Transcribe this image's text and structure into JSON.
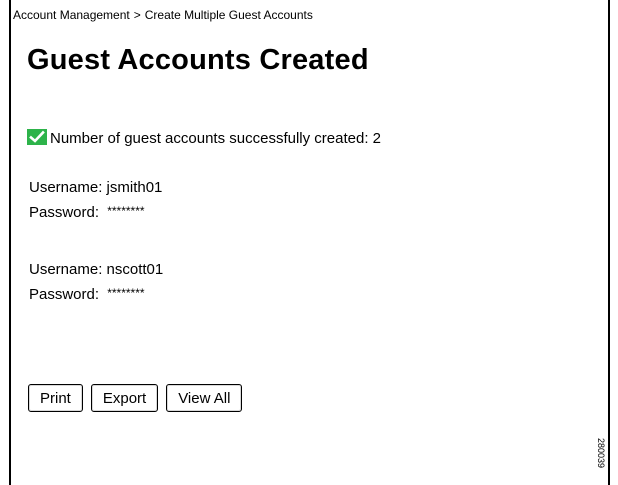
{
  "breadcrumb": {
    "parent": "Account Management",
    "separator": ">",
    "current": "Create Multiple Guest Accounts"
  },
  "page": {
    "title": "Guest Accounts Created"
  },
  "status": {
    "icon": "check-icon",
    "icon_color": "#2db34a",
    "label": "Number of guest accounts successfully created:",
    "count": "2"
  },
  "accounts": [
    {
      "username_label": "Username:",
      "username": "jsmith01",
      "password_label": "Password:",
      "password": "********"
    },
    {
      "username_label": "Username:",
      "username": "nscott01",
      "password_label": "Password:",
      "password": "********"
    }
  ],
  "actions": {
    "print_label": "Print",
    "export_label": "Export",
    "view_all_label": "View All"
  },
  "figure_id": "280039"
}
